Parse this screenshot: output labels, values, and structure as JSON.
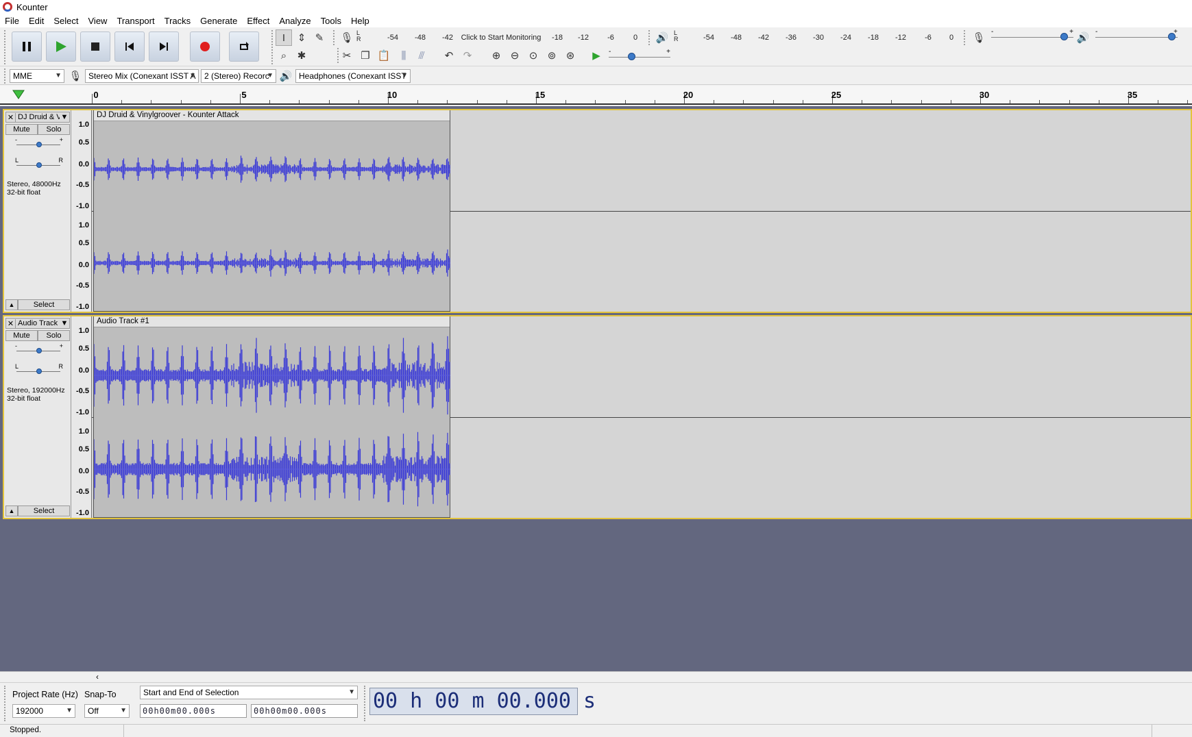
{
  "window": {
    "title": "Kounter"
  },
  "menu": [
    "File",
    "Edit",
    "Select",
    "View",
    "Transport",
    "Tracks",
    "Generate",
    "Effect",
    "Analyze",
    "Tools",
    "Help"
  ],
  "meters": {
    "record_ticks": [
      "-54",
      "-48",
      "-42",
      "-18",
      "-12",
      "-6",
      "0"
    ],
    "record_prompt": "Click to Start Monitoring",
    "play_ticks": [
      "-54",
      "-48",
      "-42",
      "-36",
      "-30",
      "-24",
      "-18",
      "-12",
      "-6",
      "0"
    ],
    "lr_l": "L",
    "lr_r": "R"
  },
  "mixer": {
    "minus": "-",
    "plus": "+",
    "record_volume": 0.95,
    "playback_volume": 1.0,
    "play_speed": 0.3
  },
  "devices": {
    "host": "MME",
    "input": "Stereo Mix (Conexant ISST A",
    "channels": "2 (Stereo) Recorc",
    "output": "Headphones (Conexant ISST"
  },
  "timeline": {
    "labels": [
      "0",
      "5",
      "10",
      "15",
      "20",
      "25",
      "30",
      "35"
    ]
  },
  "tracks": [
    {
      "name": "DJ Druid & Vi",
      "clip_name": "DJ Druid & Vinylgroover - Kounter Attack",
      "mute": "Mute",
      "solo": "Solo",
      "gain_minus": "-",
      "gain_plus": "+",
      "pan_l": "L",
      "pan_r": "R",
      "info_line1": "Stereo, 48000Hz",
      "info_line2": "32-bit float",
      "select": "Select",
      "clip_end_seconds": 12.1,
      "amplitude": 0.22
    },
    {
      "name": "Audio Track",
      "clip_name": "Audio Track #1",
      "mute": "Mute",
      "solo": "Solo",
      "gain_minus": "-",
      "gain_plus": "+",
      "pan_l": "L",
      "pan_r": "R",
      "info_line1": "Stereo, 192000Hz",
      "info_line2": "32-bit float",
      "select": "Select",
      "clip_end_seconds": 12.1,
      "amplitude": 0.6
    }
  ],
  "scale_labels": [
    "1.0",
    "0.5",
    "0.0",
    "-0.5",
    "-1.0"
  ],
  "selection_bar": {
    "project_rate_label": "Project Rate (Hz)",
    "project_rate": "192000",
    "snap_to_label": "Snap-To",
    "snap_to": "Off",
    "selection_mode": "Start and End of Selection",
    "start_time": "00h00m00.000s",
    "end_time": "00h00m00.000s",
    "audio_position": "00 h 00 m 00.000 s"
  },
  "status": {
    "text": "Stopped."
  },
  "colors": {
    "waveform": "#3a3ad6",
    "track_bg": "#d5d5d5",
    "clip_bg": "#bdbdbd",
    "empty_area": "#63677f",
    "selected_border": "#e3c43c"
  }
}
